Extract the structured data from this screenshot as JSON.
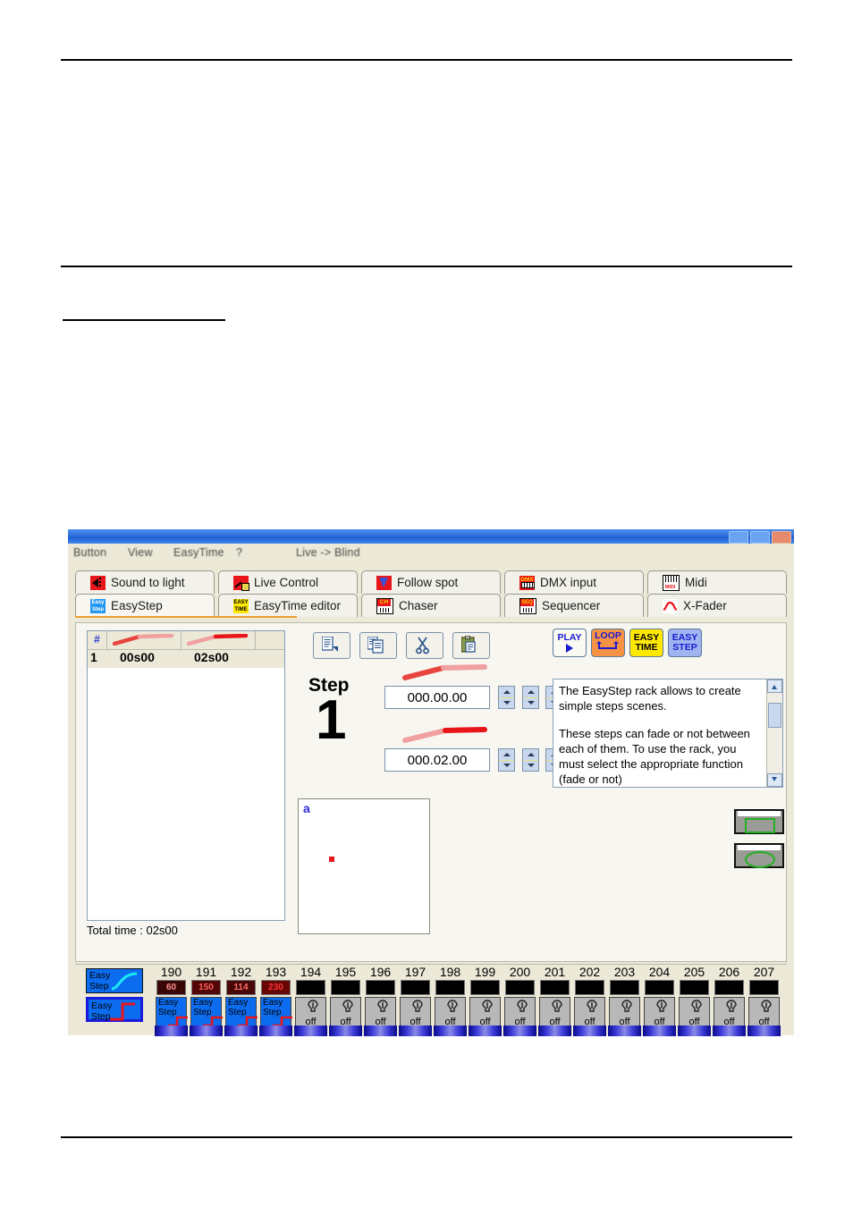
{
  "window": {
    "menu": [
      "Button",
      "View",
      "EasyTime",
      "?"
    ],
    "live_blind": "Live -> Blind"
  },
  "tabs": {
    "row1": [
      {
        "label": "Sound to light",
        "icon": "speaker-icon",
        "active": false
      },
      {
        "label": "Live Control",
        "icon": "live-control-icon",
        "active": false
      },
      {
        "label": "Follow spot",
        "icon": "follow-spot-icon",
        "active": false
      },
      {
        "label": "DMX input",
        "icon": "dmx-input-icon",
        "active": false
      },
      {
        "label": "Midi",
        "icon": "midi-icon",
        "active": false
      }
    ],
    "row2": [
      {
        "label": "EasyStep",
        "icon": "easystep-icon",
        "active": true
      },
      {
        "label": "EasyTime editor",
        "icon": "easytime-icon",
        "active": false
      },
      {
        "label": "Chaser",
        "icon": "chaser-icon",
        "active": false
      },
      {
        "label": "Sequencer",
        "icon": "sequencer-icon",
        "active": false
      },
      {
        "label": "X-Fader",
        "icon": "xfader-icon",
        "active": false
      }
    ]
  },
  "steplist": {
    "headers": [
      "#",
      "fade-time-icon",
      "wait-time-icon",
      ""
    ],
    "rows": [
      {
        "index": "1",
        "fade": "00s00",
        "wait": "02s00"
      }
    ],
    "total_time": "Total time : 02s00"
  },
  "toolbar": {
    "buttons": [
      {
        "name": "new-step-button",
        "icon": "document-new-icon"
      },
      {
        "name": "copy-button",
        "icon": "copy-icon"
      },
      {
        "name": "cut-button",
        "icon": "scissors-icon"
      },
      {
        "name": "paste-button",
        "icon": "clipboard-paste-icon"
      }
    ]
  },
  "transport": {
    "play": "PLAY",
    "loop": "LOOP",
    "easytime_line1": "EASY",
    "easytime_line2": "TIME",
    "easystep_line1": "EASY",
    "easystep_line2": "STEP"
  },
  "step_editor": {
    "label": "Step",
    "number": "1",
    "fade_time": "000.00.00",
    "wait_time": "000.02.00"
  },
  "help": {
    "paragraph1": "The EasyStep rack allows to create simple steps scenes.",
    "paragraph2": "These steps can fade or not between each of them. To use the rack, you must select the appropriate function (fade or not)"
  },
  "preview": {
    "label": "a"
  },
  "shape_buttons": [
    {
      "name": "shape-rectangle-button",
      "icon": "green-rectangle-icon"
    },
    {
      "name": "shape-ellipse-button",
      "icon": "green-ellipse-icon"
    }
  ],
  "dmx": {
    "mode_fade": {
      "line1": "Easy",
      "line2": "Step",
      "icon": "fade-curve-icon",
      "selected": false
    },
    "mode_step": {
      "line1": "Easy",
      "line2": "Step",
      "icon": "step-curve-icon",
      "selected": true
    },
    "channels": [
      {
        "num": "190",
        "value": "60",
        "on": true,
        "mode1": "Easy",
        "mode2": "Step",
        "state": "easystep"
      },
      {
        "num": "191",
        "value": "150",
        "on": true,
        "mode1": "Easy",
        "mode2": "Step",
        "state": "easystep"
      },
      {
        "num": "192",
        "value": "114",
        "on": true,
        "mode1": "Easy",
        "mode2": "Step",
        "state": "easystep"
      },
      {
        "num": "193",
        "value": "230",
        "on": true,
        "mode1": "Easy",
        "mode2": "Step",
        "state": "easystep"
      },
      {
        "num": "194",
        "value": "",
        "on": false,
        "off_label": "off",
        "state": "off"
      },
      {
        "num": "195",
        "value": "",
        "on": false,
        "off_label": "off",
        "state": "off"
      },
      {
        "num": "196",
        "value": "",
        "on": false,
        "off_label": "off",
        "state": "off"
      },
      {
        "num": "197",
        "value": "",
        "on": false,
        "off_label": "off",
        "state": "off"
      },
      {
        "num": "198",
        "value": "",
        "on": false,
        "off_label": "off",
        "state": "off"
      },
      {
        "num": "199",
        "value": "",
        "on": false,
        "off_label": "off",
        "state": "off"
      },
      {
        "num": "200",
        "value": "",
        "on": false,
        "off_label": "off",
        "state": "off"
      },
      {
        "num": "201",
        "value": "",
        "on": false,
        "off_label": "off",
        "state": "off"
      },
      {
        "num": "202",
        "value": "",
        "on": false,
        "off_label": "off",
        "state": "off"
      },
      {
        "num": "203",
        "value": "",
        "on": false,
        "off_label": "off",
        "state": "off"
      },
      {
        "num": "204",
        "value": "",
        "on": false,
        "off_label": "off",
        "state": "off"
      },
      {
        "num": "205",
        "value": "",
        "on": false,
        "off_label": "off",
        "state": "off"
      },
      {
        "num": "206",
        "value": "",
        "on": false,
        "off_label": "off",
        "state": "off"
      },
      {
        "num": "207",
        "value": "",
        "on": false,
        "off_label": "off",
        "state": "off"
      }
    ]
  },
  "colors": {
    "titlebar_blue": "#2f6fdc",
    "tab_active_underline": "#f0a030",
    "loop_orange": "#f59245",
    "easytime_yellow": "#ffe800",
    "easystep_blue": "#9fb4f0",
    "channel_blue": "#0b6cf0",
    "led_red": "#5a0d0d",
    "preview_marker": "#e8151a",
    "shape_green": "#22b022"
  }
}
